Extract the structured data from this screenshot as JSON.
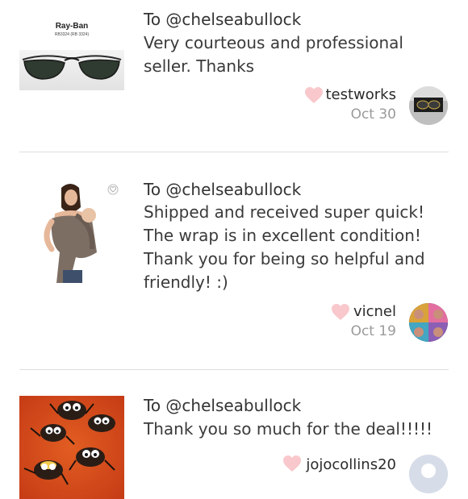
{
  "reviews": [
    {
      "to": "To @chelseabullock",
      "message_lines": [
        "Very courteous and professional",
        "seller. Thanks"
      ],
      "username": "testworks",
      "date": "Oct 30",
      "product": {
        "brand": "Ray-Ban",
        "model": "RB3324 (RB 3324)"
      }
    },
    {
      "to": "To @chelseabullock",
      "message_lines": [
        "Shipped and received super quick!",
        "The wrap is in excellent condition!",
        "Thank you for being so helpful and",
        "friendly! :)"
      ],
      "username": "vicnel",
      "date": "Oct 19"
    },
    {
      "to": "To @chelseabullock",
      "message_lines": [
        "Thank you so much for the deal!!!!!"
      ],
      "username": "jojocollins20",
      "date": ""
    }
  ],
  "colors": {
    "heart": "#f9c8cc",
    "divider": "#dedede",
    "date": "#9a9a9a",
    "text": "#3a3a3a"
  },
  "icons": {
    "like": "heart-icon",
    "product_like": "small-heart-icon"
  }
}
